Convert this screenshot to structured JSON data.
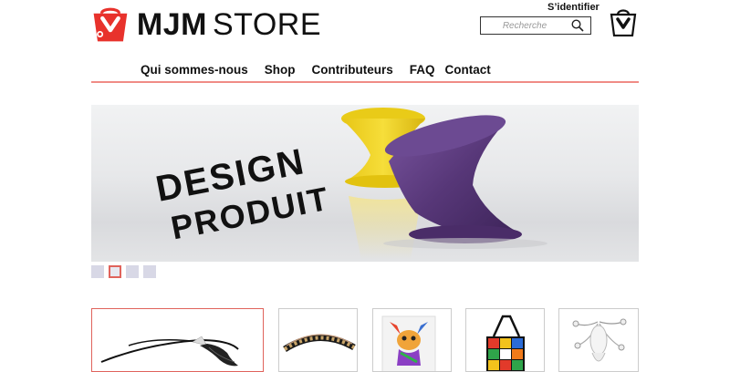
{
  "header": {
    "brand_bold": "MJM",
    "brand_light": "STORE",
    "signin_label": "S’identifier",
    "search_placeholder": "Recherche"
  },
  "nav": {
    "items": [
      {
        "label": "Qui sommes-nous"
      },
      {
        "label": "Shop"
      },
      {
        "label": "Contributeurs"
      },
      {
        "label": "FAQ"
      },
      {
        "label": "Contact"
      }
    ]
  },
  "hero": {
    "line1": "DESIGN",
    "line2": "PRODUIT",
    "active_slide": 2,
    "slide_count": 4
  },
  "products": [
    {
      "icon": "headband-feather-image"
    },
    {
      "icon": "beaded-headband-image"
    },
    {
      "icon": "chihuahua-canvas-image"
    },
    {
      "icon": "rubik-bag-image"
    },
    {
      "icon": "octopus-lamp-image"
    }
  ],
  "colors": {
    "accent": "#e0635c",
    "nav_rule": "#f08c86",
    "brand_red": "#e8322c",
    "chair_yellow": "#f2d21b",
    "chair_purple": "#5b3a7c"
  }
}
